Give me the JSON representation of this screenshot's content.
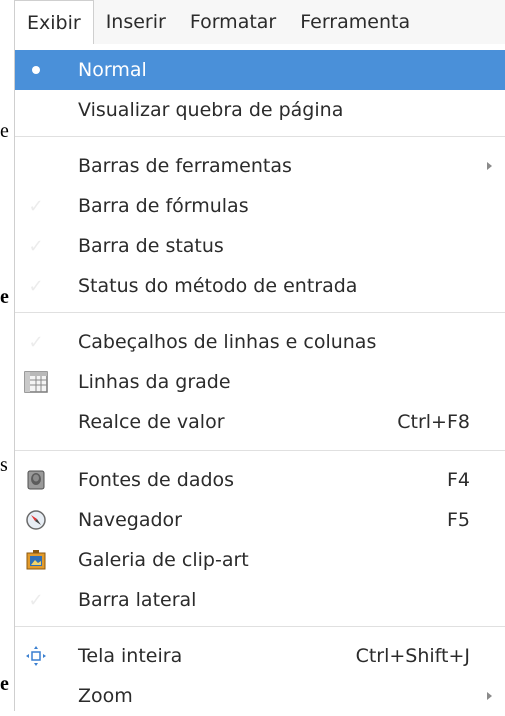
{
  "menubar": {
    "items": [
      {
        "label": "Exibir",
        "active": true
      },
      {
        "label": "Inserir",
        "active": false
      },
      {
        "label": "Formatar",
        "active": false
      },
      {
        "label": "Ferramenta",
        "active": false
      }
    ]
  },
  "background_doc": {
    "chars": [
      "e",
      "e",
      "s",
      "e"
    ]
  },
  "view_menu": {
    "items": [
      {
        "label": "Normal",
        "state": "radio-selected",
        "highlighted": true,
        "accel": ""
      },
      {
        "label": "Visualizar quebra de página",
        "accel": ""
      },
      {
        "label": "Barras de ferramentas",
        "submenu": true,
        "accel": ""
      },
      {
        "label": "Barra de fórmulas",
        "state": "check-faint",
        "accel": ""
      },
      {
        "label": "Barra de status",
        "state": "check-faint",
        "accel": ""
      },
      {
        "label": "Status do método de entrada",
        "state": "check-faint",
        "accel": ""
      },
      {
        "label": "Cabeçalhos de linhas e colunas",
        "state": "check-faint",
        "accel": ""
      },
      {
        "label": "Linhas da grade",
        "icon": "grid-lines-icon",
        "accel": ""
      },
      {
        "label": "Realce de valor",
        "accel": "Ctrl+F8"
      },
      {
        "label": "Fontes de dados",
        "icon": "database-icon",
        "accel": "F4"
      },
      {
        "label": "Navegador",
        "icon": "compass-icon",
        "accel": "F5"
      },
      {
        "label": "Galeria de clip-art",
        "icon": "gallery-icon",
        "accel": ""
      },
      {
        "label": "Barra lateral",
        "state": "check-faint",
        "accel": ""
      },
      {
        "label": "Tela inteira",
        "icon": "fullscreen-icon",
        "accel": "Ctrl+Shift+J"
      },
      {
        "label": "Zoom",
        "submenu": true,
        "accel": ""
      }
    ]
  },
  "colors": {
    "highlight": "#4a90d9",
    "text": "#2b2b2b",
    "separator": "#e0e0e0"
  }
}
